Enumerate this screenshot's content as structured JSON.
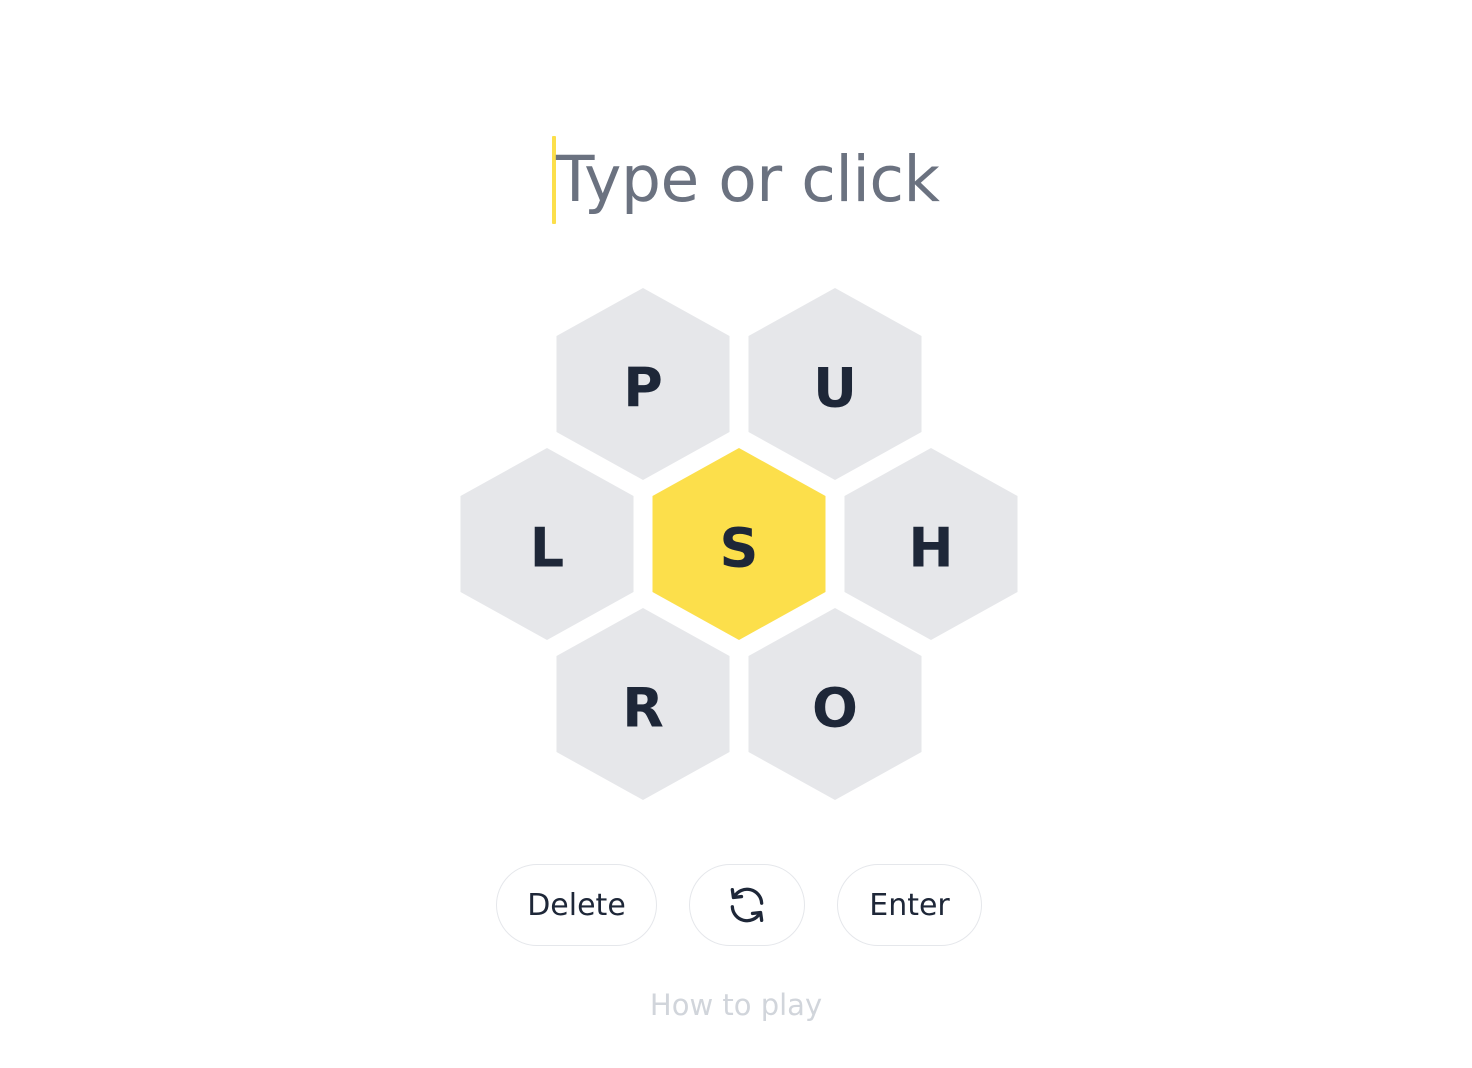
{
  "input": {
    "placeholder": "Type or click",
    "caret_color": "#fcdf4b"
  },
  "hive": {
    "center_letter": "S",
    "outer_letters": [
      "P",
      "U",
      "L",
      "H",
      "R",
      "O"
    ],
    "center_color": "#fcdf4b",
    "outer_color": "#e6e7ea",
    "letter_color": "#1e2738"
  },
  "controls": {
    "delete_label": "Delete",
    "shuffle_icon": "refresh-icon",
    "enter_label": "Enter"
  },
  "help": {
    "label": "How to play"
  }
}
